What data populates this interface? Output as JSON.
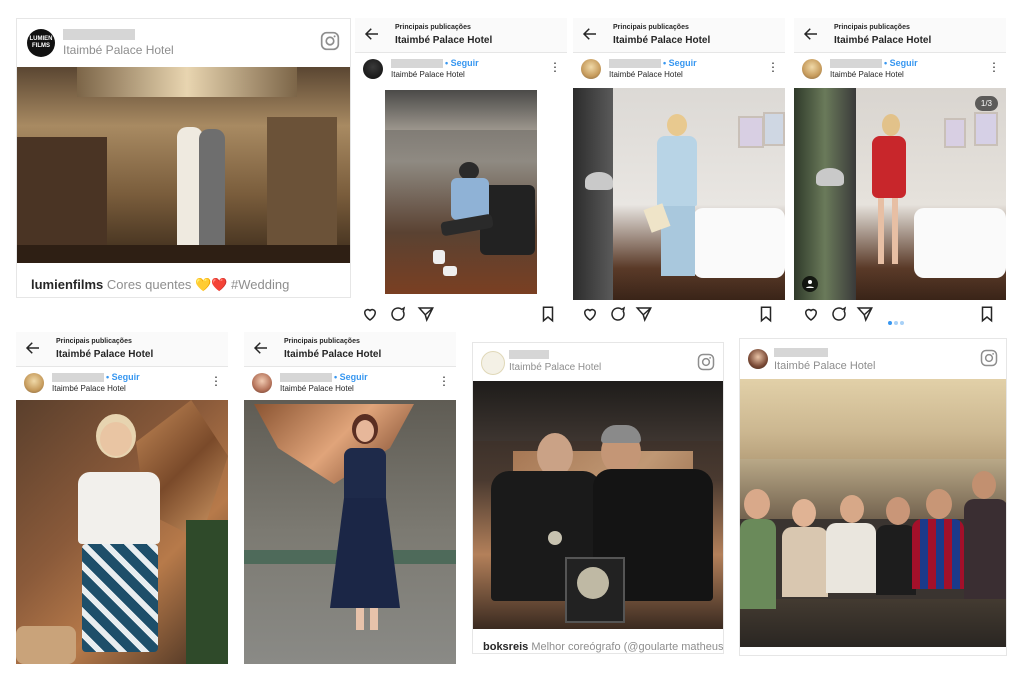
{
  "common": {
    "top_small": "Principais publicações",
    "location": "Itaimbé Palace Hotel",
    "follow": "• Seguir",
    "carousel_counter": "1/3"
  },
  "post1": {
    "logo_text": "LUMIEN FILMS",
    "username_caption": "lumienfilms",
    "caption_text": "Cores quentes 💛❤️ #Wedding"
  },
  "post7": {
    "username_caption": "boksreis",
    "caption_text": "Melhor coreógrafo (@goularte matheus)"
  },
  "icons": {
    "back": "arrow-left-icon",
    "heart": "heart-icon",
    "comment": "comment-icon",
    "share": "paper-plane-icon",
    "bookmark": "bookmark-icon",
    "instagram": "instagram-icon",
    "more": "more-vertical-icon",
    "user_tag": "user-tag-icon"
  },
  "colors": {
    "link_blue": "#3897f0",
    "text": "#262626",
    "muted": "#8e8e8e"
  }
}
